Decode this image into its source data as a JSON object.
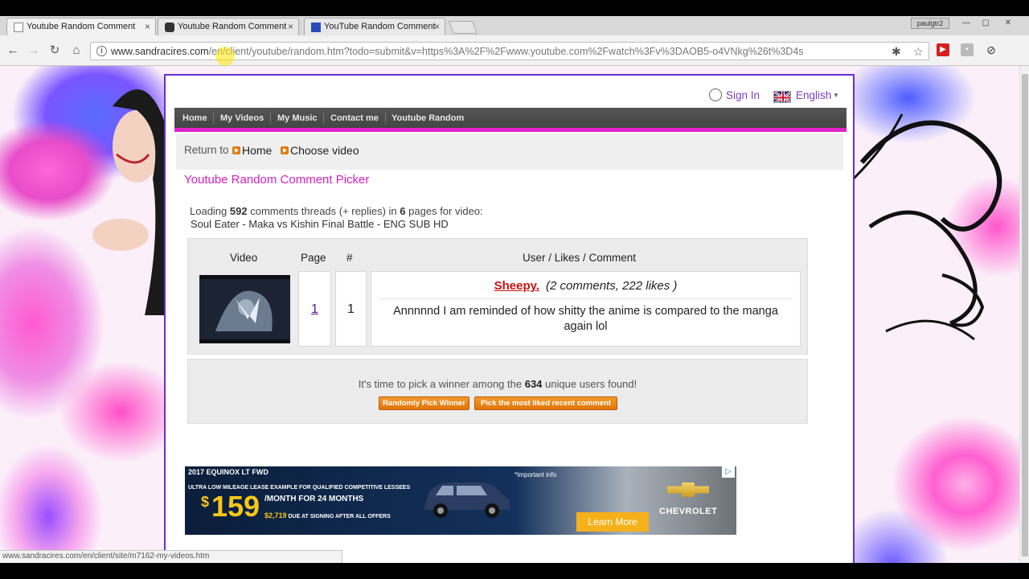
{
  "browser": {
    "tabs": [
      {
        "title": "Youtube Random Comment",
        "active": true
      },
      {
        "title": "Youtube Random Comment",
        "active": false
      },
      {
        "title": "YouTube Random Comment",
        "active": false
      }
    ],
    "tab_close": "×",
    "user_chip": "paulgtr2",
    "window_buttons": {
      "minimize": "—",
      "maximize": "▢",
      "close": "✕"
    },
    "nav": {
      "back": "←",
      "forward": "→",
      "reload": "↻",
      "home": "⌂"
    },
    "url": {
      "host": "www.sandracires.com",
      "path": "/en/client/youtube/random.htm?todo=submit&v=https%3A%2F%2Fwww.youtube.com%2Fwatch%3Fv%3DAOB5-o4VNkg%26t%3D4s"
    },
    "status_url": "www.sandracires.com/en/client/site/m7162-my-videos.htm"
  },
  "header": {
    "sign_in": "Sign In",
    "language": "English"
  },
  "menu": [
    "Home",
    "My Videos",
    "My Music",
    "Contact me",
    "Youtube Random"
  ],
  "return_bar": {
    "label": "Return to",
    "links": [
      "Home",
      "Choose video"
    ]
  },
  "title": "Youtube Random Comment Picker",
  "loading": {
    "prefix": "Loading",
    "threads": "592",
    "middle": "comments threads (+ replies) in",
    "pages": "6",
    "suffix": "pages for video:",
    "video_title": "Soul Eater - Maka vs Kishin Final Battle - ENG SUB HD"
  },
  "results": {
    "headers": {
      "video": "Video",
      "page": "Page",
      "rank": "#",
      "comment": "User / Likes / Comment"
    },
    "row": {
      "page": "1",
      "rank": "1",
      "user": "Sheepy.",
      "stats": "(2 comments, 222 likes )",
      "comment": "Annnnnd I am reminded of how shitty the anime is compared to the manga again lol"
    }
  },
  "winner": {
    "prefix": "It's time to pick a winner among the",
    "count": "634",
    "suffix": "unique users found!",
    "buttons": [
      "Randomly Pick Winner",
      "Pick the most liked recent comment"
    ]
  },
  "ad": {
    "model": "2017 EQUINOX LT FWD",
    "line1": "ULTRA LOW MILEAGE LEASE EXAMPLE FOR QUALIFIED COMPETITIVE LESSEES",
    "dollar": "$",
    "price": "159",
    "per_month": "/MONTH FOR 24 MONTHS",
    "due_amount": "$2,719",
    "due_text": "DUE AT SIGNING AFTER ALL OFFERS",
    "important": "*Important info",
    "learn_more": "Learn More",
    "brand": "CHEVROLET",
    "adchoices": "▷"
  },
  "colors": {
    "accent_magenta": "#e21fc9",
    "title_magenta": "#d41fc0",
    "page_border": "#6a2cd6",
    "orange_button": "#e0750a",
    "user_red": "#cc1111"
  }
}
